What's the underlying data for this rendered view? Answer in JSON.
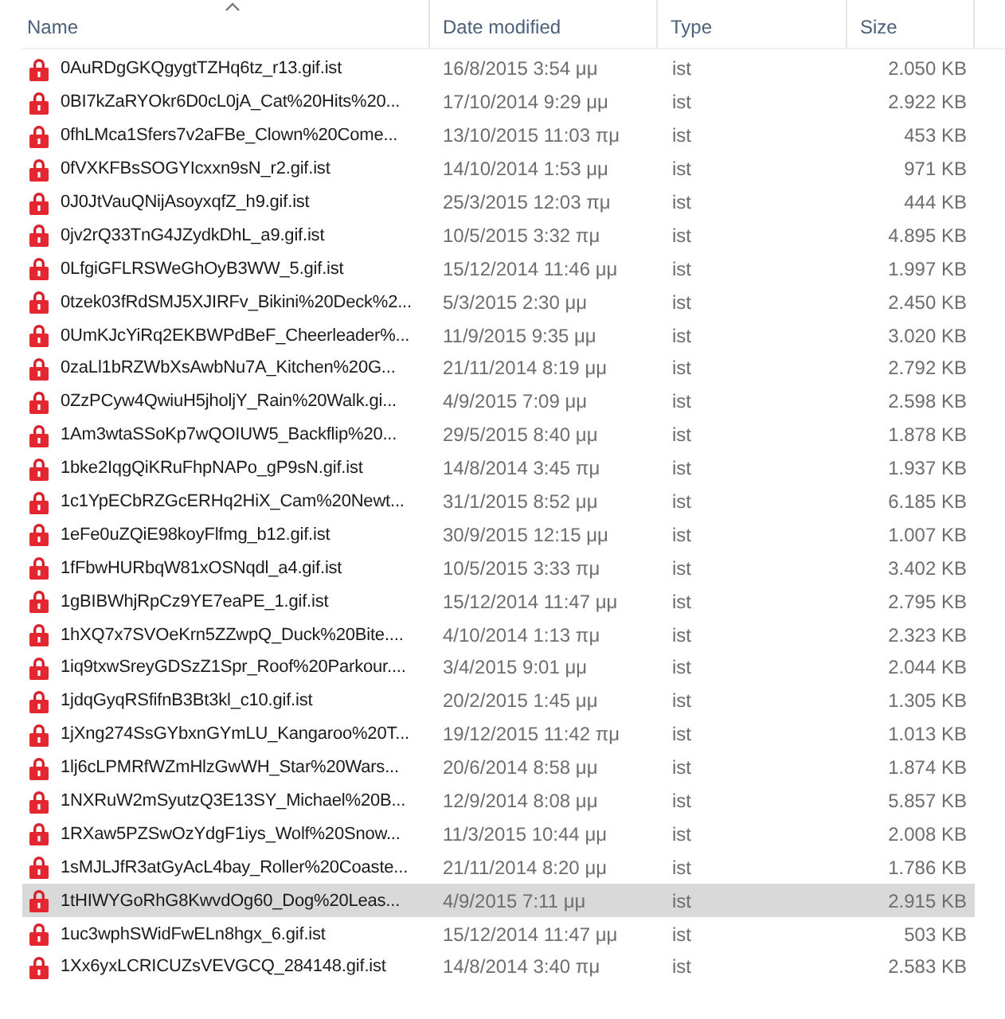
{
  "columns": [
    {
      "label": "Name",
      "sorted": true
    },
    {
      "label": "Date modified",
      "sorted": false
    },
    {
      "label": "Type",
      "sorted": false
    },
    {
      "label": "Size",
      "sorted": false
    }
  ],
  "files": [
    {
      "name": "0AuRDgGKQgygtTZHq6tz_r13.gif.ist",
      "date": "16/8/2015 3:54 μμ",
      "type": "ist",
      "size": "2.050 KB",
      "selected": false
    },
    {
      "name": "0BI7kZaRYOkr6D0cL0jA_Cat%20Hits%20...",
      "date": "17/10/2014 9:29 μμ",
      "type": "ist",
      "size": "2.922 KB",
      "selected": false
    },
    {
      "name": "0fhLMca1Sfers7v2aFBe_Clown%20Come...",
      "date": "13/10/2015 11:03 πμ",
      "type": "ist",
      "size": "453 KB",
      "selected": false
    },
    {
      "name": "0fVXKFBsSOGYIcxxn9sN_r2.gif.ist",
      "date": "14/10/2014 1:53 μμ",
      "type": "ist",
      "size": "971 KB",
      "selected": false
    },
    {
      "name": "0J0JtVauQNijAsoyxqfZ_h9.gif.ist",
      "date": "25/3/2015 12:03 πμ",
      "type": "ist",
      "size": "444 KB",
      "selected": false
    },
    {
      "name": "0jv2rQ33TnG4JZydkDhL_a9.gif.ist",
      "date": "10/5/2015 3:32 πμ",
      "type": "ist",
      "size": "4.895 KB",
      "selected": false
    },
    {
      "name": "0LfgiGFLRSWeGhOyB3WW_5.gif.ist",
      "date": "15/12/2014 11:46 μμ",
      "type": "ist",
      "size": "1.997 KB",
      "selected": false
    },
    {
      "name": "0tzek03fRdSMJ5XJIRFv_Bikini%20Deck%2...",
      "date": "5/3/2015 2:30 μμ",
      "type": "ist",
      "size": "2.450 KB",
      "selected": false
    },
    {
      "name": "0UmKJcYiRq2EKBWPdBeF_Cheerleader%...",
      "date": "11/9/2015 9:35 μμ",
      "type": "ist",
      "size": "3.020 KB",
      "selected": false
    },
    {
      "name": "0zaLl1bRZWbXsAwbNu7A_Kitchen%20G...",
      "date": "21/11/2014 8:19 μμ",
      "type": "ist",
      "size": "2.792 KB",
      "selected": false
    },
    {
      "name": "0ZzPCyw4QwiuH5jholjY_Rain%20Walk.gi...",
      "date": "4/9/2015 7:09 μμ",
      "type": "ist",
      "size": "2.598 KB",
      "selected": false
    },
    {
      "name": "1Am3wtaSSoKp7wQOIUW5_Backflip%20...",
      "date": "29/5/2015 8:40 μμ",
      "type": "ist",
      "size": "1.878 KB",
      "selected": false
    },
    {
      "name": "1bke2IqgQiKRuFhpNAPo_gP9sN.gif.ist",
      "date": "14/8/2014 3:45 πμ",
      "type": "ist",
      "size": "1.937 KB",
      "selected": false
    },
    {
      "name": "1c1YpECbRZGcERHq2HiX_Cam%20Newt...",
      "date": "31/1/2015 8:52 μμ",
      "type": "ist",
      "size": "6.185 KB",
      "selected": false
    },
    {
      "name": "1eFe0uZQiE98koyFlfmg_b12.gif.ist",
      "date": "30/9/2015 12:15 μμ",
      "type": "ist",
      "size": "1.007 KB",
      "selected": false
    },
    {
      "name": "1fFbwHURbqW81xOSNqdl_a4.gif.ist",
      "date": "10/5/2015 3:33 πμ",
      "type": "ist",
      "size": "3.402 KB",
      "selected": false
    },
    {
      "name": "1gBIBWhjRpCz9YE7eaPE_1.gif.ist",
      "date": "15/12/2014 11:47 μμ",
      "type": "ist",
      "size": "2.795 KB",
      "selected": false
    },
    {
      "name": "1hXQ7x7SVOeKrn5ZZwpQ_Duck%20Bite....",
      "date": "4/10/2014 1:13 πμ",
      "type": "ist",
      "size": "2.323 KB",
      "selected": false
    },
    {
      "name": "1iq9txwSreyGDSzZ1Spr_Roof%20Parkour....",
      "date": "3/4/2015 9:01 μμ",
      "type": "ist",
      "size": "2.044 KB",
      "selected": false
    },
    {
      "name": "1jdqGyqRSfifnB3Bt3kl_c10.gif.ist",
      "date": "20/2/2015 1:45 μμ",
      "type": "ist",
      "size": "1.305 KB",
      "selected": false
    },
    {
      "name": "1jXng274SsGYbxnGYmLU_Kangaroo%20T...",
      "date": "19/12/2015 11:42 πμ",
      "type": "ist",
      "size": "1.013 KB",
      "selected": false
    },
    {
      "name": "1lj6cLPMRfWZmHlzGwWH_Star%20Wars...",
      "date": "20/6/2014 8:58 μμ",
      "type": "ist",
      "size": "1.874 KB",
      "selected": false
    },
    {
      "name": "1NXRuW2mSyutzQ3E13SY_Michael%20B...",
      "date": "12/9/2014 8:08 μμ",
      "type": "ist",
      "size": "5.857 KB",
      "selected": false
    },
    {
      "name": "1RXaw5PZSwOzYdgF1iys_Wolf%20Snow...",
      "date": "11/3/2015 10:44 μμ",
      "type": "ist",
      "size": "2.008 KB",
      "selected": false
    },
    {
      "name": "1sMJLJfR3atGyAcL4bay_Roller%20Coaste...",
      "date": "21/11/2014 8:20 μμ",
      "type": "ist",
      "size": "1.786 KB",
      "selected": false
    },
    {
      "name": "1tHIWYGoRhG8KwvdOg60_Dog%20Leas...",
      "date": "4/9/2015 7:11 μμ",
      "type": "ist",
      "size": "2.915 KB",
      "selected": true
    },
    {
      "name": "1uc3wphSWidFwELn8hgx_6.gif.ist",
      "date": "15/12/2014 11:47 μμ",
      "type": "ist",
      "size": "503 KB",
      "selected": false
    },
    {
      "name": "1Xx6yxLCRICUZsVEVGCQ_284148.gif.ist",
      "date": "14/8/2014 3:40 πμ",
      "type": "ist",
      "size": "2.583 KB",
      "selected": false
    }
  ]
}
